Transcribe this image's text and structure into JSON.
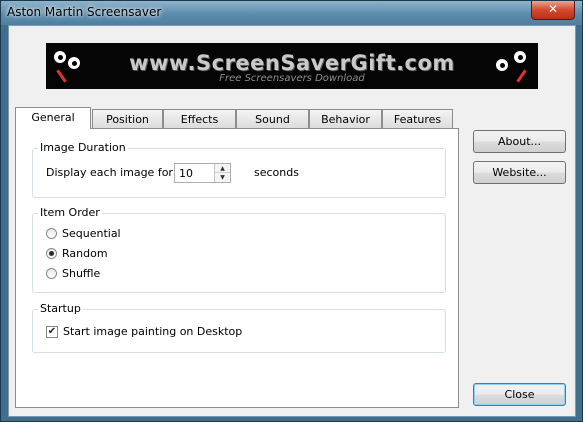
{
  "window": {
    "title": "Aston Martin Screensaver",
    "close_glyph": "✕"
  },
  "banner": {
    "text": "www.ScreenSaverGift.com",
    "subtext": "Free Screensavers Download"
  },
  "tabs": [
    {
      "label": "General",
      "active": true
    },
    {
      "label": "Position",
      "active": false
    },
    {
      "label": "Effects",
      "active": false
    },
    {
      "label": "Sound",
      "active": false
    },
    {
      "label": "Behavior",
      "active": false
    },
    {
      "label": "Features",
      "active": false
    }
  ],
  "general": {
    "image_duration": {
      "title": "Image Duration",
      "label": "Display each image for",
      "value": "10",
      "unit": "seconds",
      "spin_up_glyph": "▲",
      "spin_down_glyph": "▼"
    },
    "item_order": {
      "title": "Item Order",
      "options": [
        {
          "label": "Sequential",
          "selected": false
        },
        {
          "label": "Random",
          "selected": true
        },
        {
          "label": "Shuffle",
          "selected": false
        }
      ]
    },
    "startup": {
      "title": "Startup",
      "checkbox_label": "Start image painting on Desktop",
      "checked": true,
      "check_glyph": "✔"
    }
  },
  "buttons": {
    "about": "About...",
    "website": "Website...",
    "close": "Close"
  },
  "colors": {
    "titlebar": "#5d8bab",
    "close_button": "#d2492c",
    "banner_bg": "#050505",
    "dialog_bg": "#f0f0f0"
  }
}
